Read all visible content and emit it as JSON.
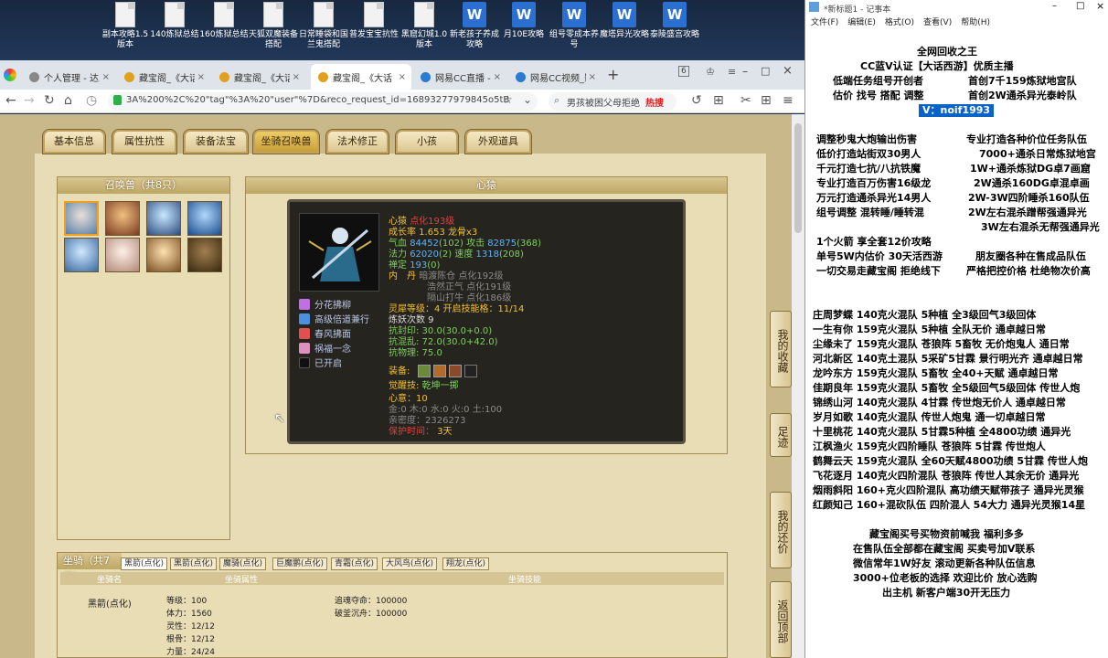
{
  "desktop": {
    "icons": [
      {
        "label": "副本攻略1.5版本",
        "type": "file"
      },
      {
        "label": "140炼狱总结",
        "type": "file"
      },
      {
        "label": "160炼狱总结",
        "type": "file"
      },
      {
        "label": "天狐双魔装备搭配",
        "type": "file"
      },
      {
        "label": "日常睡袋和国兰鬼搭配",
        "type": "file"
      },
      {
        "label": "普发宝宝抗性",
        "type": "file"
      },
      {
        "label": "黑窟幻城1.0版本",
        "type": "file"
      },
      {
        "label": "新老孩子养成攻略",
        "type": "word"
      },
      {
        "label": "月10E攻略",
        "type": "word"
      },
      {
        "label": "组号零成本养号",
        "type": "word"
      },
      {
        "label": "魔塔异光攻略",
        "type": "word"
      },
      {
        "label": "泰陵盛宫攻略",
        "type": "word"
      }
    ]
  },
  "browser": {
    "tabs": [
      {
        "label": "个人管理 - 达人",
        "color": "#666"
      },
      {
        "label": "藏宝阁_《大话",
        "color": "#e0a020"
      },
      {
        "label": "藏宝阁_《大话",
        "color": "#e0a020"
      },
      {
        "label": "藏宝阁_《大话",
        "color": "#e0a020",
        "active": true
      },
      {
        "label": "网易CC直播 - ",
        "color": "#2a7ad0"
      },
      {
        "label": "网易CC视频_影",
        "color": "#2a7ad0"
      }
    ],
    "tab_count": "6",
    "url": "3A%200%2C%20\"tag\"%3A%20\"user\"%7D&reco_request_id=16893277979845o5tB",
    "search": "男孩被困父母拒绝",
    "hot_label": "热搜"
  },
  "game": {
    "tabs": [
      "基本信息",
      "属性抗性",
      "装备法宝",
      "坐骑召唤兽",
      "法术修正",
      "小孩",
      "外观道具"
    ],
    "summon_panel_title": "召唤兽（共8只）",
    "detail_title": "心猿",
    "pet": {
      "name": "心猿",
      "name_tag": "点化193级",
      "growth": "成长率 1.653 龙骨x3",
      "hp_label": "气血",
      "hp": "84452",
      "hp_add": "(102)",
      "atk_label": "攻击",
      "atk": "82875",
      "atk_add": "(368)",
      "mp_label": "法力",
      "mp": "62020",
      "mp_add": "(2)",
      "spd_label": "速度",
      "spd": "1318",
      "spd_add": "(208)",
      "def_label": "禅定",
      "def": "193",
      "def_add": "(0)",
      "neidan_label": "内　丹",
      "neidan": [
        "暗渡陈仓 点化192级",
        "浩然正气 点化191级",
        "隔山打牛 点化186级"
      ],
      "skill_level": "灵犀等级：4 开启技能格：11/14",
      "refine": "炼妖次数 9",
      "res1": "抗封印: 30.0(30.0+0.0)",
      "res2": "抗混乱: 72.0(30.0+42.0)",
      "res3": "抗物理: 75.0",
      "equip_label": "装备:",
      "awaken_label": "觉醒技:",
      "awaken": "乾坤一掷",
      "spirit": "心意：10",
      "elements": "金:0 木:0 水:0 火:0 土:100",
      "intimacy": "亲密度：2326273",
      "protect_label": "保护时间：",
      "protect": "3天",
      "skills": [
        "分花拂柳",
        "高级倍道兼行",
        "春风拂面",
        "祸福一念",
        "已开启"
      ]
    },
    "mount_tab_label": "坐骑（共7只）",
    "mount_tabs": [
      "黑箭(点化)",
      "黑箭(点化)",
      "魔骑(点化)",
      "巨魔鹏(点化)",
      "青霜(点化)",
      "大风鸟(点化)",
      "翔龙(点化)"
    ],
    "mount_cols": [
      "坐骑名",
      "坐骑属性",
      "坐骑技能"
    ],
    "mount_name": "黑箭(点化)",
    "mount_stats": [
      "等级：100",
      "体力：1560",
      "灵性：12/12",
      "根骨：12/12",
      "力量：24/24"
    ],
    "mount_skills": [
      "追魂夺命：100000",
      "破釜沉舟：100000"
    ],
    "side_buttons": [
      "我的收藏",
      "足迹",
      "我的还价",
      "返回顶部"
    ]
  },
  "notepad": {
    "title": "*新标题1 - 记事本",
    "menu": [
      "文件(F)",
      "编辑(E)",
      "格式(O)",
      "查看(V)",
      "帮助(H)"
    ],
    "header": [
      "全网回收之王",
      "CC蓝V认证【大话西游】优质主播",
      "低端任务组号开创者",
      "首创7千159炼狱地宫队",
      "估价 找号 搭配 调整",
      "首创2W通杀异光泰岭队"
    ],
    "vx": "V：noif1993",
    "list_a": [
      "调整秒鬼大炮输出伤害",
      "专业打造各种价位任务队伍",
      "低价打造站街双30男人",
      "7000+通杀日常炼狱地宫",
      "千元打造七抗/八抗铁魔",
      "1W+通杀炼狱DG卓7画窟",
      "专业打造百万伤害16级龙",
      "2W通杀160DG卓混卓画",
      "万元打造通杀异光14男人",
      "2W-3W四阶睡杀160队伍",
      "组号调整 混转睡/睡转混",
      "2W左右混杀蹭帮强通异光",
      "3W左右混杀无帮强通异光"
    ],
    "list_b": [
      "1个火箭 享全套12价攻略",
      "单号5W内估价 30天活西游",
      "朋友圈各种在售成品队伍",
      "一切交易走藏宝阁 拒绝线下",
      "严格把控价格 杜绝物次价高"
    ],
    "teams": [
      "庄周梦蝶 140克火混队 5种植 全3级回气3级回体",
      "一生有你 159克火混队 5种植 全队无价 通卓越日常",
      "尘缘未了 159克火混队 苍狼阵 5畜牧 无价炮鬼人 通日常",
      "河北新区 140克土混队 5采矿5甘霖 景行明光齐 通卓越日常",
      "龙吟东方 159克火混队 5畜牧 全40+天赋 通卓越日常",
      "佳期良年 159克火混队 5畜牧 全5级回气5级回体 传世人炮",
      "锦绣山河 140克火混队 4甘霖 传世炮无价人 通卓越日常",
      "岁月如歌 140克火混队 传世人炮鬼 通一切卓越日常",
      "十里桃花 140克火混队 5甘霖5种植 全4800功绩 通异光",
      "江枫渔火 159克火四阶睡队 苍狼阵 5甘霖 传世炮人",
      "鹤舞云天 159克火混队 全60天赋4800功绩 5甘霖 传世人炮",
      "飞花逐月 140克火四阶混队 苍狼阵 传世人其余无价 通异光",
      "烟雨斜阳 160+克火四阶混队 高功绩天赋带孩子 通异光灵猴",
      "红颜知己 160+混砍队伍 四阶混人 54大力 通异光灵猴14星"
    ],
    "footer": [
      "藏宝阁买号买物资前喊我 福利多多",
      "在售队伍全部都在藏宝阁 买卖号加V联系",
      "微信常年1W好友 滚动更新各种队伍信息",
      "3000+位老板的选择 欢迎比价 放心选购",
      "出主机 新客户端30开无压力"
    ]
  }
}
